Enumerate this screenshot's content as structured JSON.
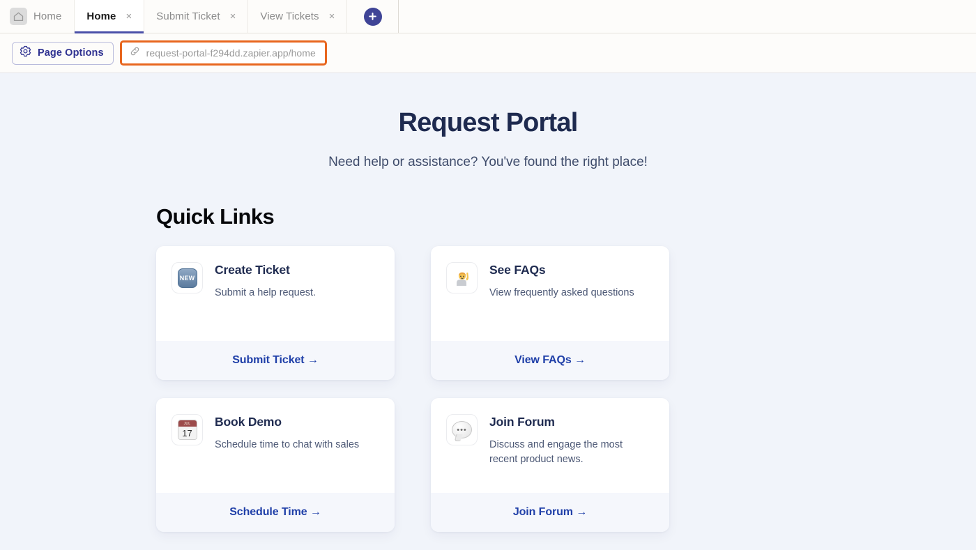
{
  "browser": {
    "home_tab": {
      "label": "Home",
      "icon": "house-icon"
    },
    "tabs": [
      {
        "label": "Home",
        "active": true,
        "close": "×"
      },
      {
        "label": "Submit Ticket",
        "active": false,
        "close": "×"
      },
      {
        "label": "View Tickets",
        "active": false,
        "close": "×"
      }
    ],
    "new_tab_button": {
      "icon": "plus-icon",
      "label": "+"
    }
  },
  "toolbar": {
    "page_options_label": "Page Options",
    "page_options_icon": "gear-icon",
    "url_icon": "link-icon",
    "url_value": "request-portal-f294dd.zapier.app/home",
    "highlight_color": "#e8661e"
  },
  "hero": {
    "title": "Request Portal",
    "subtitle": "Need help or assistance? You've found the right place!"
  },
  "quick_links": {
    "section_title": "Quick Links",
    "cards": [
      {
        "icon": "new-badge-icon",
        "icon_text": "NEW",
        "title": "Create Ticket",
        "description": "Submit a help request.",
        "cta": "Submit Ticket →"
      },
      {
        "icon": "person-raising-hand-icon",
        "icon_text": "🙋",
        "title": "See FAQs",
        "description": "View frequently asked questions",
        "cta": "View FAQs →"
      },
      {
        "icon": "calendar-icon",
        "icon_text": "17",
        "icon_month": "JUL",
        "title": "Book Demo",
        "description": "Schedule time to chat with sales",
        "cta": "Schedule Time →"
      },
      {
        "icon": "speech-balloon-icon",
        "icon_text": "•••",
        "title": "Join Forum",
        "description": "Discuss and engage the most recent product news.",
        "cta": "Join Forum →"
      }
    ]
  },
  "colors": {
    "page_background": "#f1f4fa",
    "toolbar_background": "#fdfcfa",
    "accent_blue": "#1f3fa8",
    "brand_indigo": "#3f4496",
    "heading_navy": "#1e2a4f"
  }
}
